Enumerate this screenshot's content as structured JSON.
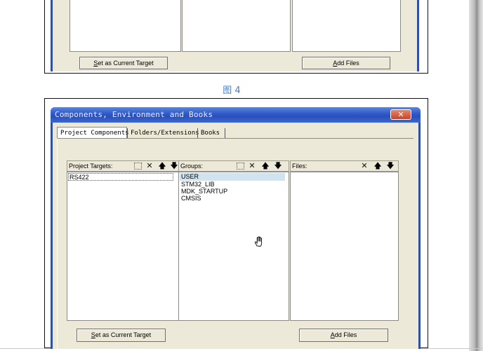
{
  "top_dialog": {
    "set_target_button": "Set as Current Target",
    "set_target_mnemonic": "S",
    "set_target_rest": "et as Current Target",
    "add_files_button": "Add Files",
    "add_files_mnemonic": "A",
    "add_files_rest": "dd Files"
  },
  "caption": "图 4",
  "dialog": {
    "title": "Components, Environment and Books",
    "close_glyph": "✕",
    "tabs": [
      {
        "label": "Project Components",
        "active": true
      },
      {
        "label": "Folders/Extensions",
        "active": false
      },
      {
        "label": "Books",
        "active": false
      }
    ],
    "targets": {
      "header": "Project Targets:",
      "items": [
        "RS422"
      ],
      "selected": 0
    },
    "groups": {
      "header": "Groups:",
      "items": [
        "USER",
        "STM32_LIB",
        "MDK_STARTUP",
        "CMSIS"
      ],
      "selected": 0
    },
    "files": {
      "header": "Files:",
      "items": []
    },
    "icons": {
      "new": "⬚",
      "delete": "✕",
      "up": "🡅",
      "down": "🡇"
    },
    "set_target_mnemonic": "S",
    "set_target_rest": "et as Current Target",
    "add_files_mnemonic": "A",
    "add_files_rest": "dd Files"
  },
  "cursor": "hand-cursor"
}
